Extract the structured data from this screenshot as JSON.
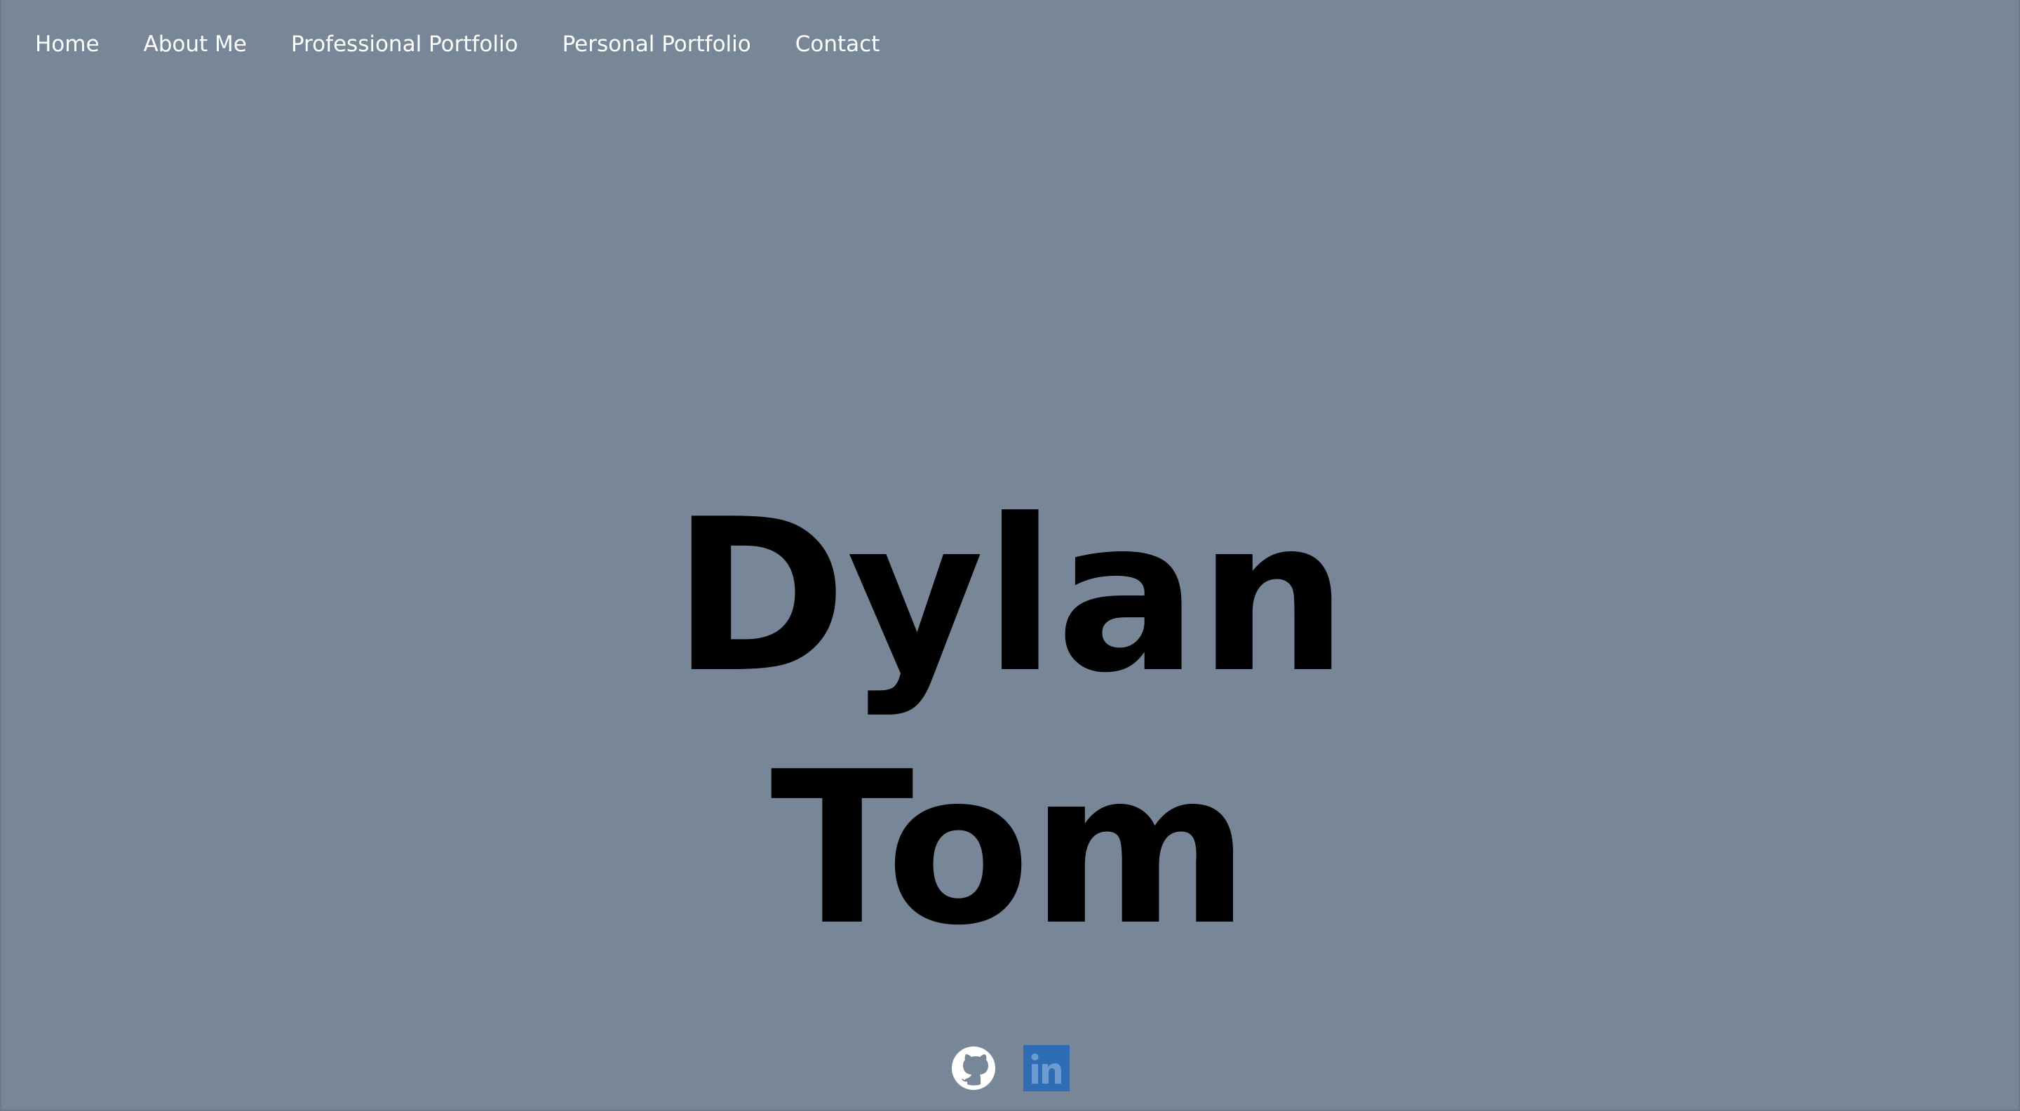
{
  "nav": {
    "items": [
      {
        "label": "Home"
      },
      {
        "label": "About Me"
      },
      {
        "label": "Professional Portfolio"
      },
      {
        "label": "Personal Portfolio"
      },
      {
        "label": "Contact"
      }
    ]
  },
  "hero": {
    "first_name": "Dylan",
    "last_name": "Tom"
  },
  "social": {
    "github_icon": "github-icon",
    "linkedin_icon": "linkedin-icon",
    "linkedin_text": "in"
  },
  "colors": {
    "background": "#778797",
    "nav_text": "#ffffff",
    "heading": "#000000",
    "linkedin": "#2f6cb6"
  }
}
